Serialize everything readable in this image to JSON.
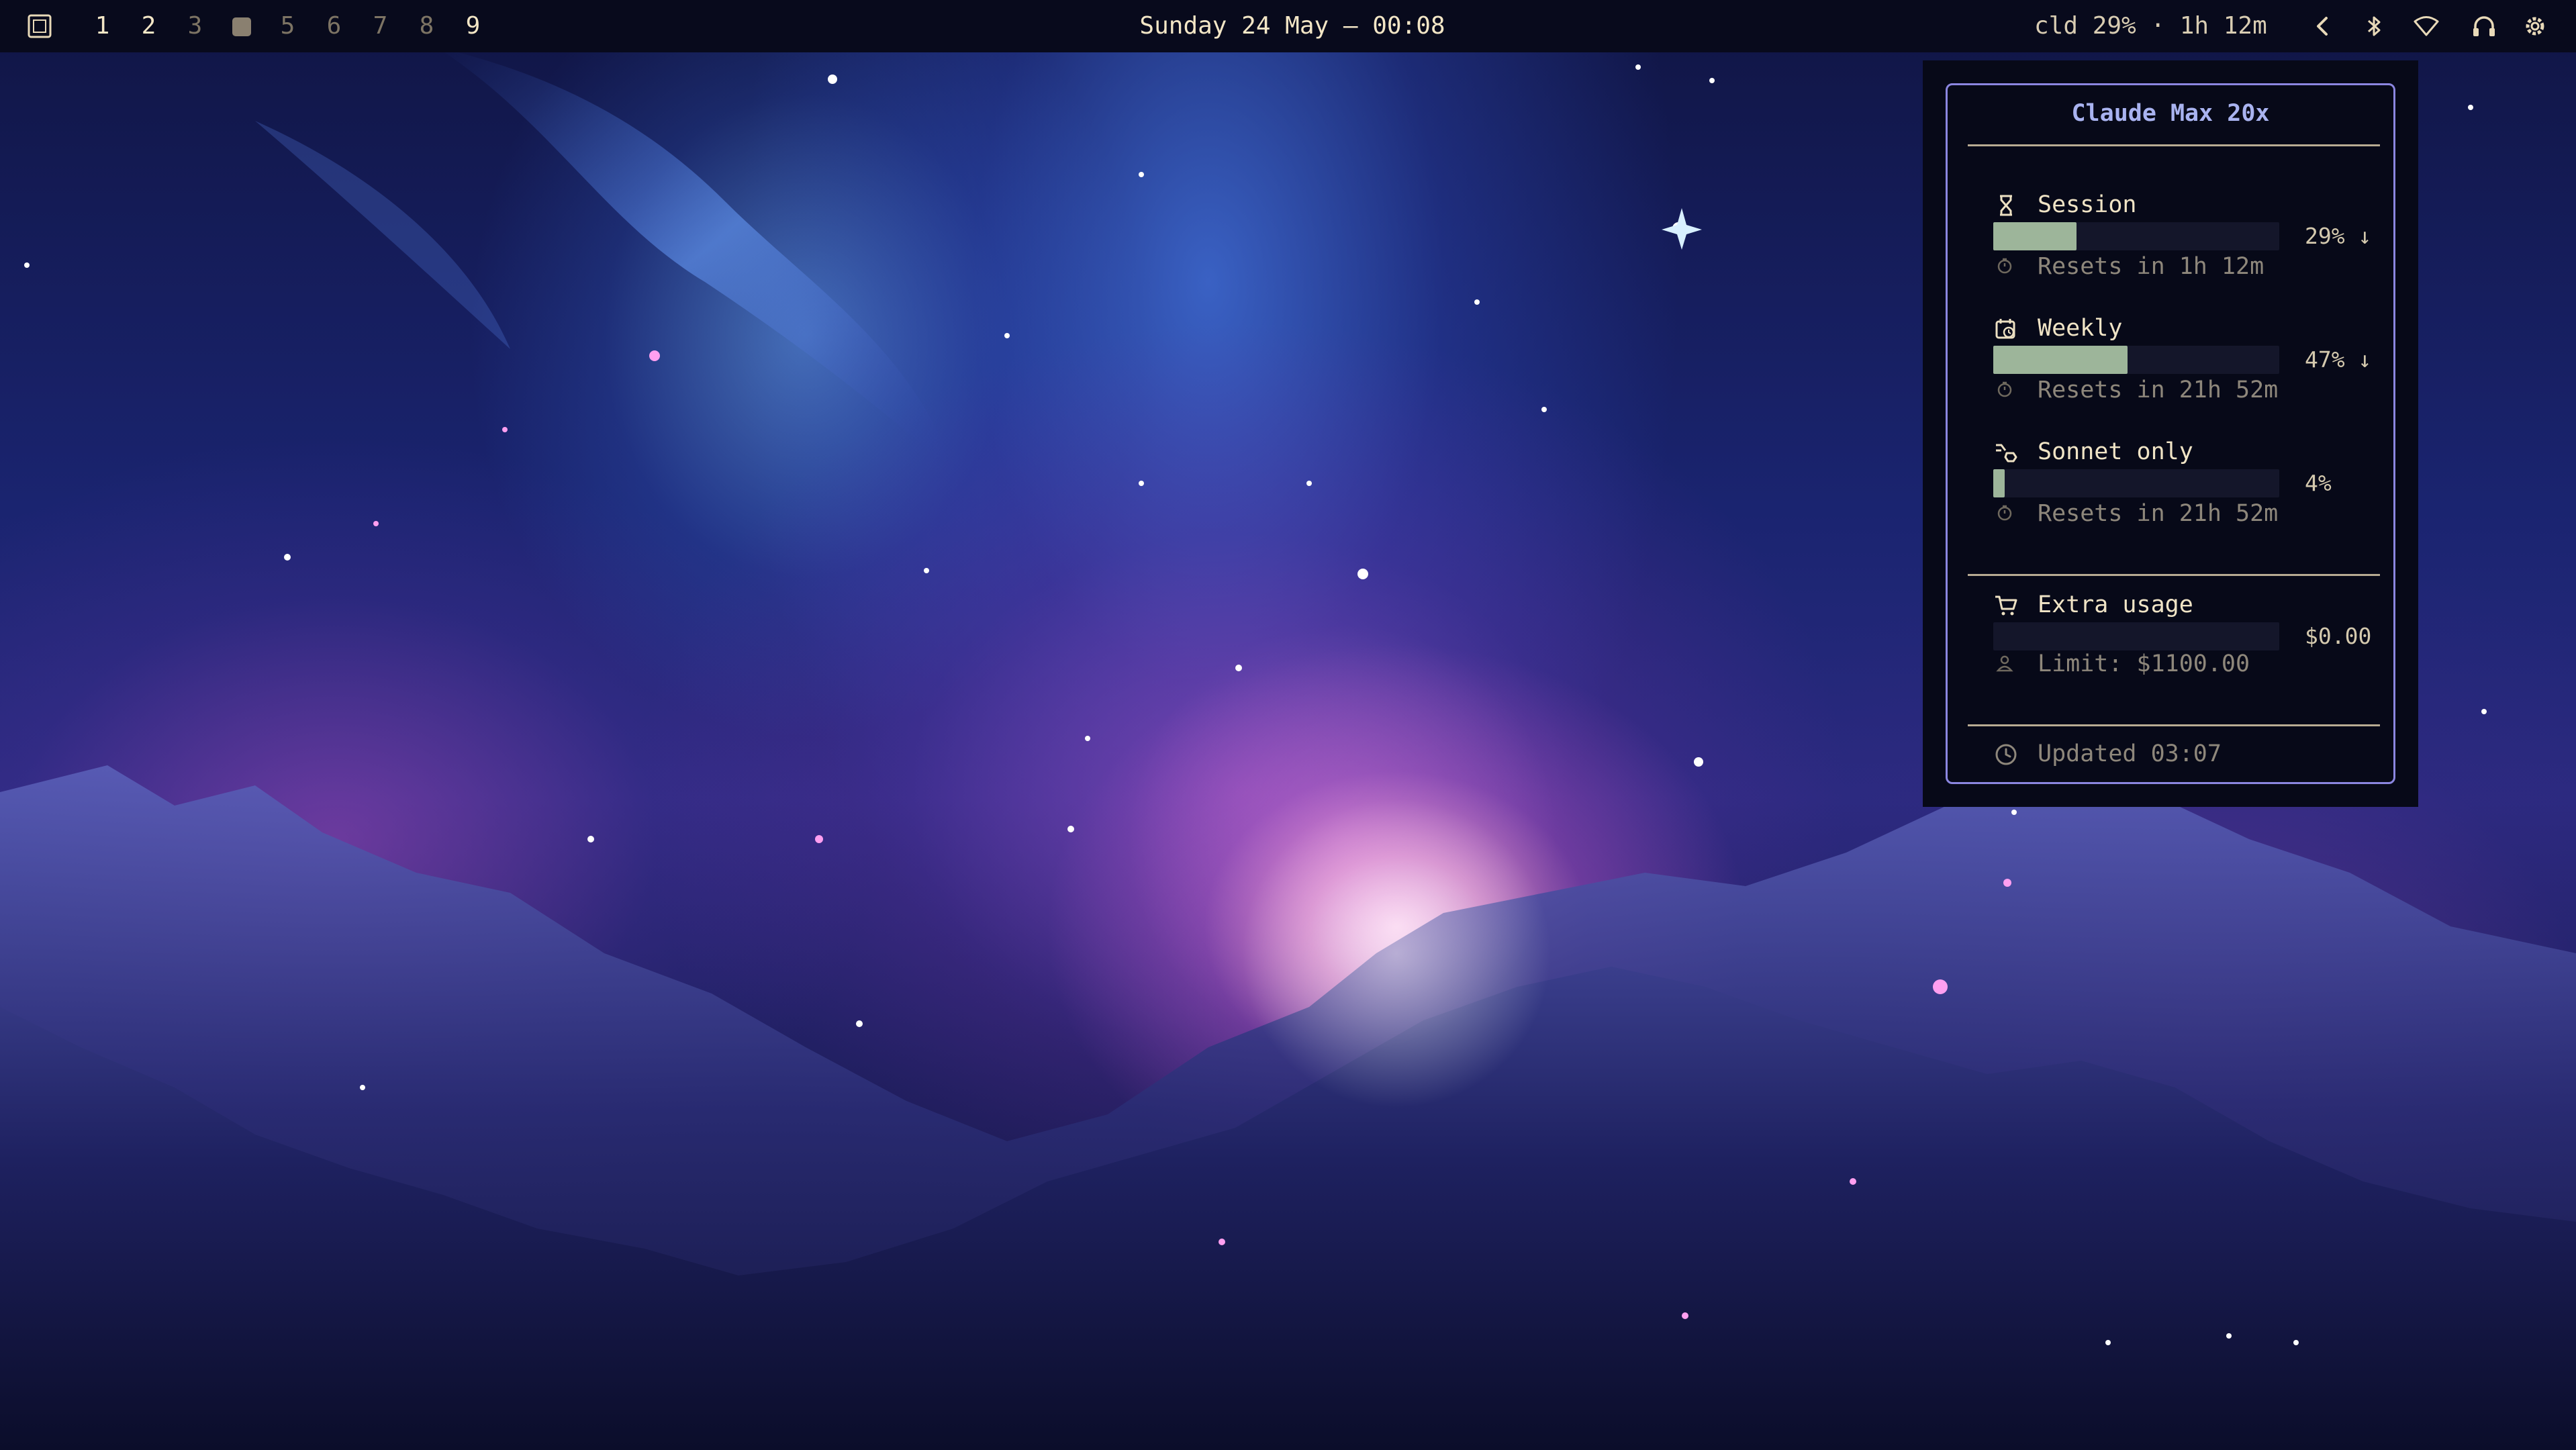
{
  "topbar": {
    "workspaces": [
      {
        "label": "1",
        "state": "occupied"
      },
      {
        "label": "2",
        "state": "occupied"
      },
      {
        "label": "3",
        "state": "empty"
      },
      {
        "label": "",
        "state": "active"
      },
      {
        "label": "5",
        "state": "empty"
      },
      {
        "label": "6",
        "state": "empty"
      },
      {
        "label": "7",
        "state": "empty"
      },
      {
        "label": "8",
        "state": "empty"
      },
      {
        "label": "9",
        "state": "occupied"
      }
    ],
    "clock": "Sunday 24 May — 00:08",
    "status": "cld 29% · 1h 12m",
    "tray_icons": [
      "chevron-left-icon",
      "bluetooth-icon",
      "wifi-icon",
      "headphones-icon",
      "settings-icon"
    ]
  },
  "panel": {
    "title": "Claude Max 20x",
    "session": {
      "label": "Session",
      "percent": 29,
      "value_text": "29% ↓",
      "reset_text": "Resets in 1h 12m"
    },
    "weekly": {
      "label": "Weekly",
      "percent": 47,
      "value_text": "47% ↓",
      "reset_text": "Resets in 21h 52m"
    },
    "sonnet": {
      "label": "Sonnet only",
      "percent": 4,
      "value_text": "4%",
      "reset_text": "Resets in 21h 52m"
    },
    "extra": {
      "label": "Extra usage",
      "percent": 0,
      "value_text": "$0.00",
      "limit_text": "Limit: $1100.00"
    },
    "updated": "Updated 03:07"
  },
  "colors": {
    "accent": "#8b86e0",
    "title": "#a9b3f0",
    "bar_fill": "#9db59a",
    "text": "#ece0c2",
    "muted": "#8e877b"
  }
}
